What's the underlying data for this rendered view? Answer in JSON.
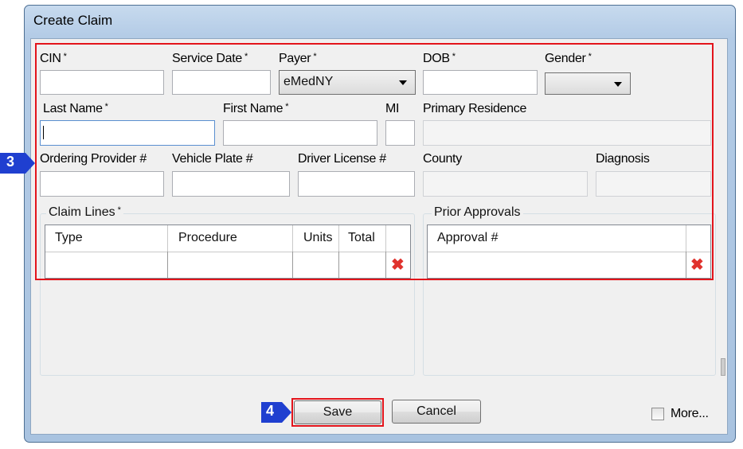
{
  "window": {
    "title": "Create Claim"
  },
  "form": {
    "cin_label": "CIN",
    "service_date_label": "Service Date",
    "payer_label": "Payer",
    "payer_value": "eMedNY",
    "dob_label": "DOB",
    "gender_label": "Gender",
    "gender_value": "",
    "last_name_label": "Last Name",
    "first_name_label": "First Name",
    "mi_label": "MI",
    "primary_residence_label": "Primary Residence",
    "ordering_provider_label": "Ordering Provider #",
    "vehicle_plate_label": "Vehicle Plate #",
    "driver_license_label": "Driver License #",
    "county_label": "County",
    "diagnosis_label": "Diagnosis",
    "required_mark": "*"
  },
  "claim_lines": {
    "title": "Claim Lines",
    "columns": [
      "Type",
      "Procedure",
      "Units",
      "Total"
    ]
  },
  "prior_approvals": {
    "title": "Prior Approvals",
    "columns": [
      "Approval #"
    ]
  },
  "buttons": {
    "save": "Save",
    "cancel": "Cancel"
  },
  "more": {
    "label": "More...",
    "checked": false
  },
  "callouts": {
    "step3": "3",
    "step4": "4"
  },
  "colors": {
    "highlight": "#e3141b",
    "callout": "#1f3fd0",
    "delete_icon": "#e0322d"
  },
  "icons": {
    "delete": "x-delete-icon",
    "dropdown": "chevron-down-icon"
  }
}
